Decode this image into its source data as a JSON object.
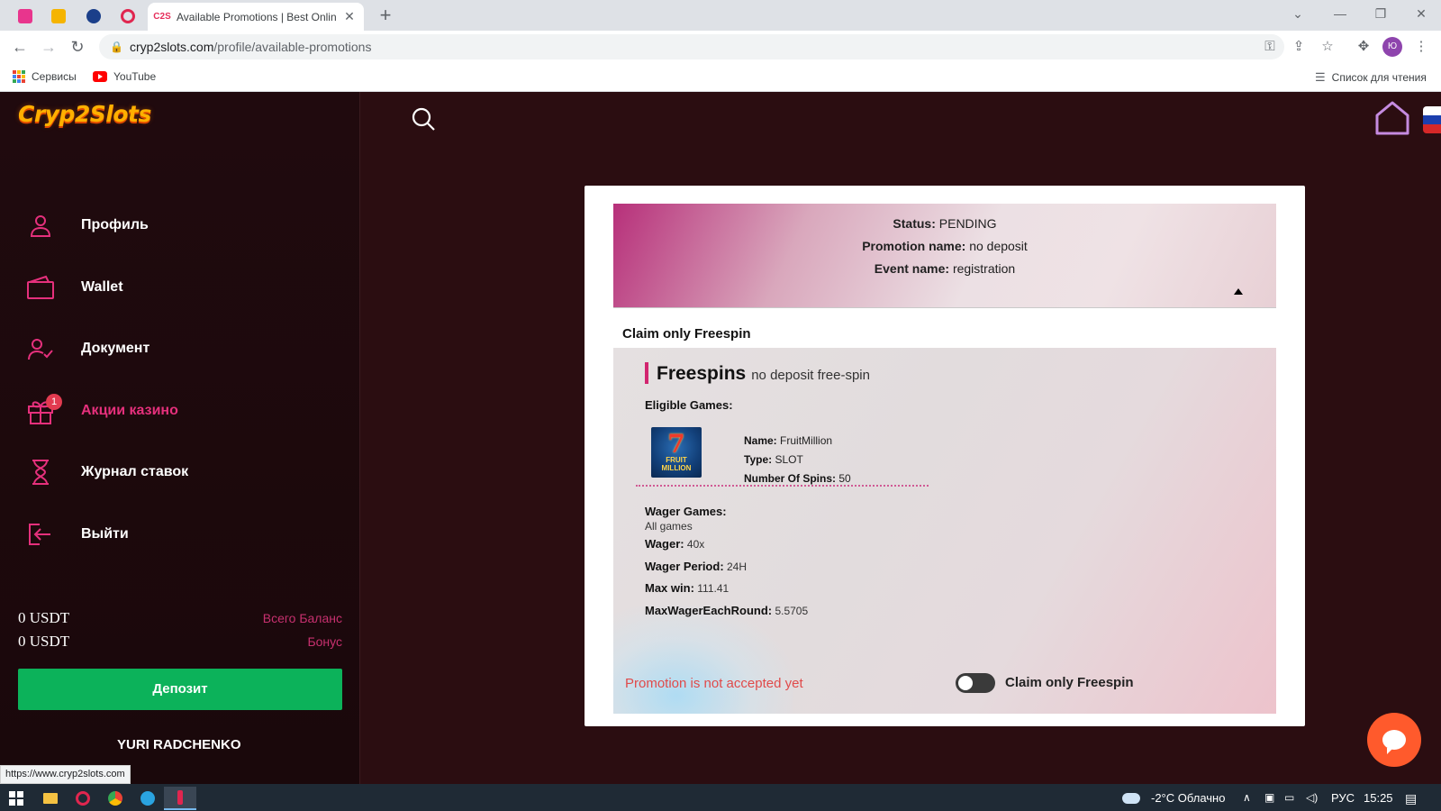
{
  "browser": {
    "tab_title": "Available Promotions | Best Onlin",
    "url_host": "cryp2slots.com",
    "url_path": "/profile/available-promotions",
    "profile_initial": "Ю",
    "bookmarks": [
      "Сервисы",
      "YouTube"
    ],
    "reading_list": "Список для чтения",
    "status_url": "https://www.cryp2slots.com"
  },
  "site": {
    "logo": "Cryp2Slots",
    "menu": [
      "Профиль",
      "Wallet",
      "Документ",
      "Акции казино",
      "Журнал ставок",
      "Выйти"
    ],
    "promo_badge": "1",
    "balance_amount": "0 USDT",
    "balance_label": "Всего Баланс",
    "bonus_amount": "0 USDT",
    "bonus_label": "Бонус",
    "deposit_button": "Депозит",
    "user_name": "YURI RADCHENKO"
  },
  "promo": {
    "status_label": "Status:",
    "status_value": "PENDING",
    "name_label": "Promotion name:",
    "name_value": "no deposit",
    "event_label": "Event name:",
    "event_value": "registration",
    "claim_title": "Claim only Freespin",
    "fs_title": "Freespins",
    "fs_subtitle": "no deposit free-spin",
    "eligible_label": "Eligible Games:",
    "game": {
      "name_label": "Name:",
      "name": "FruitMillion",
      "type_label": "Type:",
      "type": "SLOT",
      "spins_label": "Number Of Spins:",
      "spins": "50",
      "thumb_text": "FRUIT MILLION"
    },
    "wager_games_label": "Wager Games:",
    "wager_games_value": "All games",
    "wager_label": "Wager:",
    "wager_value": "40x",
    "period_label": "Wager Period:",
    "period_value": "24H",
    "maxwin_label": "Max win:",
    "maxwin_value": "111.41",
    "maxround_label": "MaxWagerEachRound:",
    "maxround_value": "5.5705",
    "not_accepted": "Promotion is not accepted yet",
    "toggle_label": "Claim only Freespin",
    "toggle_on": false
  },
  "taskbar": {
    "weather": "-2°C  Облачно",
    "lang": "РУС",
    "time": "15:25"
  },
  "colors": {
    "accent_pink": "#e5307c",
    "deposit_green": "#0cb25a",
    "chat_orange": "#ff5a2c",
    "logo_yellow": "#ffb000"
  }
}
